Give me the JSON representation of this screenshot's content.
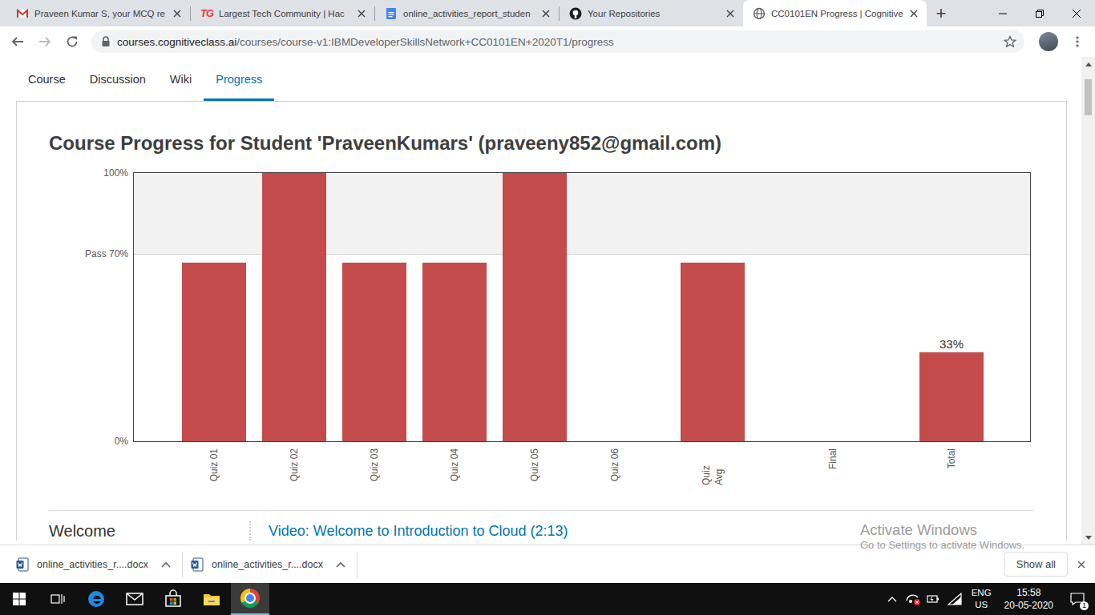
{
  "browser": {
    "tabs": [
      {
        "title": "Praveen Kumar S, your MCQ re",
        "kind": "gmail",
        "selected": false
      },
      {
        "title": "Largest Tech Community | Hac",
        "kind": "tg",
        "icon_text": "TG",
        "selected": false
      },
      {
        "title": "online_activities_report_studen",
        "kind": "docs",
        "selected": false
      },
      {
        "title": "Your Repositories",
        "kind": "github",
        "selected": false
      },
      {
        "title": "CC0101EN Progress | Cognitive",
        "kind": "globe",
        "selected": true
      }
    ],
    "new_tab": "+",
    "address_bar": {
      "host": "courses.cognitiveclass.ai",
      "path": "/courses/course-v1:IBMDeveloperSkillsNetwork+CC0101EN+2020T1/progress",
      "back_enabled": true,
      "forward_enabled": false,
      "bookmarked": false
    }
  },
  "page": {
    "nav": [
      {
        "label": "Course",
        "selected": false
      },
      {
        "label": "Discussion",
        "selected": false
      },
      {
        "label": "Wiki",
        "selected": false
      },
      {
        "label": "Progress",
        "selected": true
      }
    ],
    "heading": "Course Progress for Student 'PraveenKumars' (praveeny852@gmail.com)",
    "chart": {
      "ticks": [
        {
          "label": "100%",
          "value": 100,
          "kind": "bound"
        },
        {
          "label": "Pass 70%",
          "value": 70,
          "kind": "pass"
        },
        {
          "label": "0%",
          "value": 0,
          "kind": "bound"
        }
      ],
      "categories": [
        {
          "label": "Quiz 01",
          "kind": "quiz"
        },
        {
          "label": "Quiz 02",
          "kind": "quiz"
        },
        {
          "label": "Quiz 03",
          "kind": "quiz"
        },
        {
          "label": "Quiz 04",
          "kind": "quiz"
        },
        {
          "label": "Quiz 05",
          "kind": "quiz"
        },
        {
          "label": "Quiz 06",
          "kind": "quiz"
        },
        {
          "label": "Quiz Avg",
          "kind": "avg"
        },
        {
          "label": "Final",
          "kind": "final"
        },
        {
          "label": "Total",
          "kind": "total"
        }
      ],
      "values": [
        66.7,
        100,
        66.7,
        66.7,
        100,
        0,
        66.7,
        0,
        33
      ],
      "annotations": [
        {
          "index": 8,
          "text": "33%"
        }
      ]
    },
    "sections": [
      {
        "title": "Welcome",
        "items": [
          "Video: Welcome to Introduction to Cloud (2:13)"
        ]
      }
    ],
    "scrollbar": {
      "position": 0.02,
      "thumb_share": 0.08
    }
  },
  "downloads": {
    "items": [
      {
        "name": "online_activities_r....docx"
      },
      {
        "name": "online_activities_r....docx"
      }
    ],
    "show_all": "Show all"
  },
  "watermark": {
    "title": "Activate Windows",
    "subtitle": "Go to Settings to activate Windows."
  },
  "taskbar": {
    "apps": [
      {
        "kind": "edge",
        "active": false
      },
      {
        "kind": "mail",
        "active": false
      },
      {
        "kind": "store",
        "active": false
      },
      {
        "kind": "explorer",
        "active": false
      },
      {
        "kind": "chrome",
        "active": true
      }
    ],
    "tray": {
      "network_ok": false,
      "language": "ENG",
      "region": "US",
      "time": "15:58",
      "date": "20-05-2020",
      "notifications": "1"
    }
  }
}
